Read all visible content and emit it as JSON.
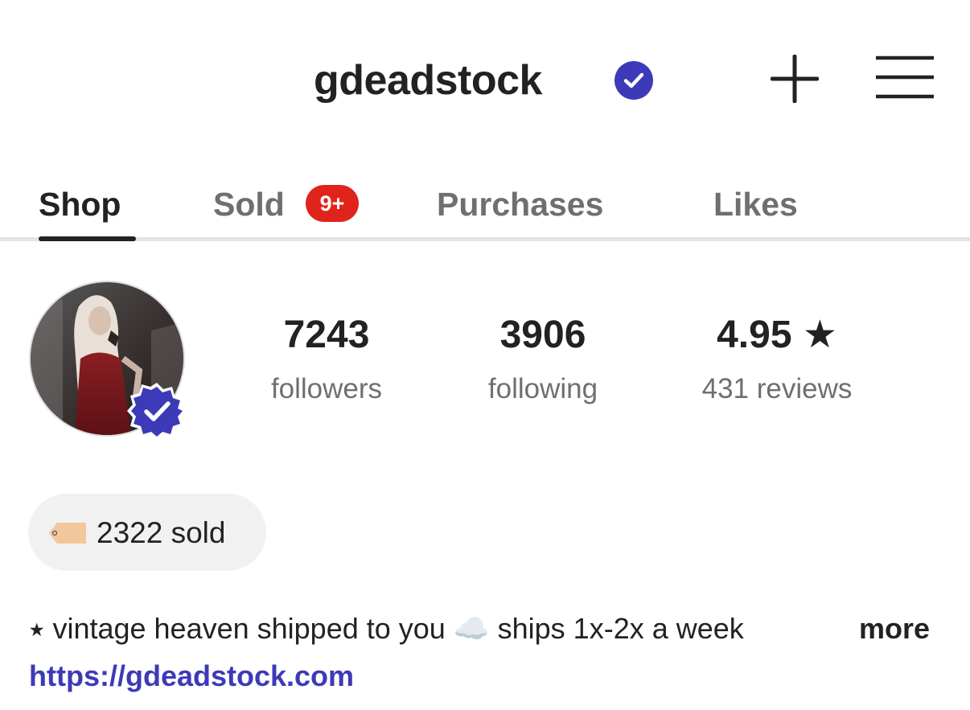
{
  "header": {
    "username": "gdeadstock"
  },
  "tabs": [
    {
      "label": "Shop",
      "active": true
    },
    {
      "label": "Sold",
      "badge": "9+"
    },
    {
      "label": "Purchases"
    },
    {
      "label": "Likes"
    }
  ],
  "stats": [
    {
      "value": "7243",
      "label": "followers"
    },
    {
      "value": "3906",
      "label": "following"
    },
    {
      "value": "4.95 ★",
      "label": "431 reviews"
    }
  ],
  "sold_pill": {
    "text": "2322 sold"
  },
  "bio": {
    "text": "⭑ vintage heaven shipped to you ☁️ ships 1x-2x a week",
    "more_label": "more"
  },
  "website": "https://gdeadstock.com",
  "colors": {
    "verified": "#3d3ab8",
    "badge": "#e0241b",
    "link": "#3d3ab8"
  }
}
